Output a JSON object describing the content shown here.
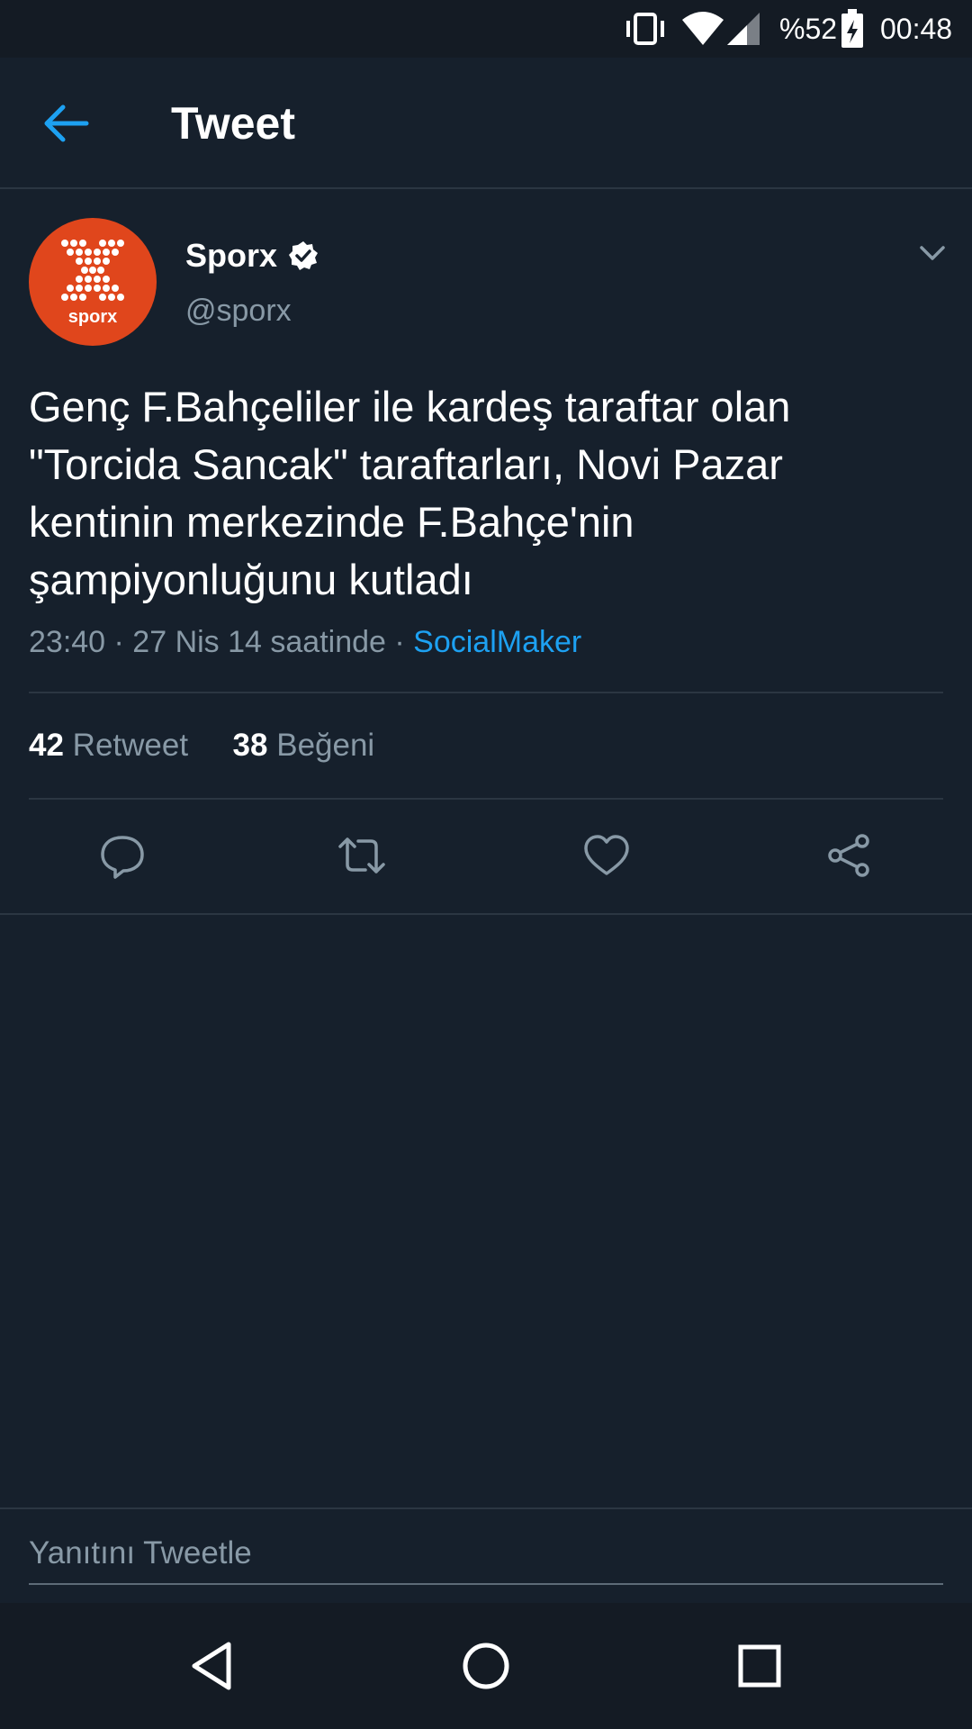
{
  "status_bar": {
    "battery": "%52",
    "time": "00:48",
    "icons": [
      "vibrate-icon",
      "wifi-icon",
      "signal-icon",
      "battery-charging-icon"
    ]
  },
  "app_bar": {
    "title": "Tweet",
    "back_icon": "arrow-left-icon"
  },
  "tweet": {
    "author_name": "Sporx",
    "author_handle": "@sporx",
    "verified": true,
    "text": "Genç F.Bahçeliler ile kardeş taraftar olan \"Torcida Sancak\" taraftarları, Novi Pazar kentinin merkezinde F.Bahçe'nin şampiyonluğunu kutladı",
    "timestamp": "23:40 · 27 Nis 14 saatinde · ",
    "source": "SocialMaker",
    "retweet_count": "42",
    "retweet_label": "Retweet",
    "like_count": "38",
    "like_label": "Beğeni",
    "avatar_text": "sporx"
  },
  "actions": [
    "reply-icon",
    "retweet-icon",
    "like-icon",
    "share-icon"
  ],
  "reply_box": {
    "placeholder": "Yanıtını Tweetle"
  },
  "colors": {
    "background": "#16202c",
    "accent": "#1da1f2",
    "secondary_text": "#8899a6",
    "avatar_bg": "#e0461c"
  }
}
